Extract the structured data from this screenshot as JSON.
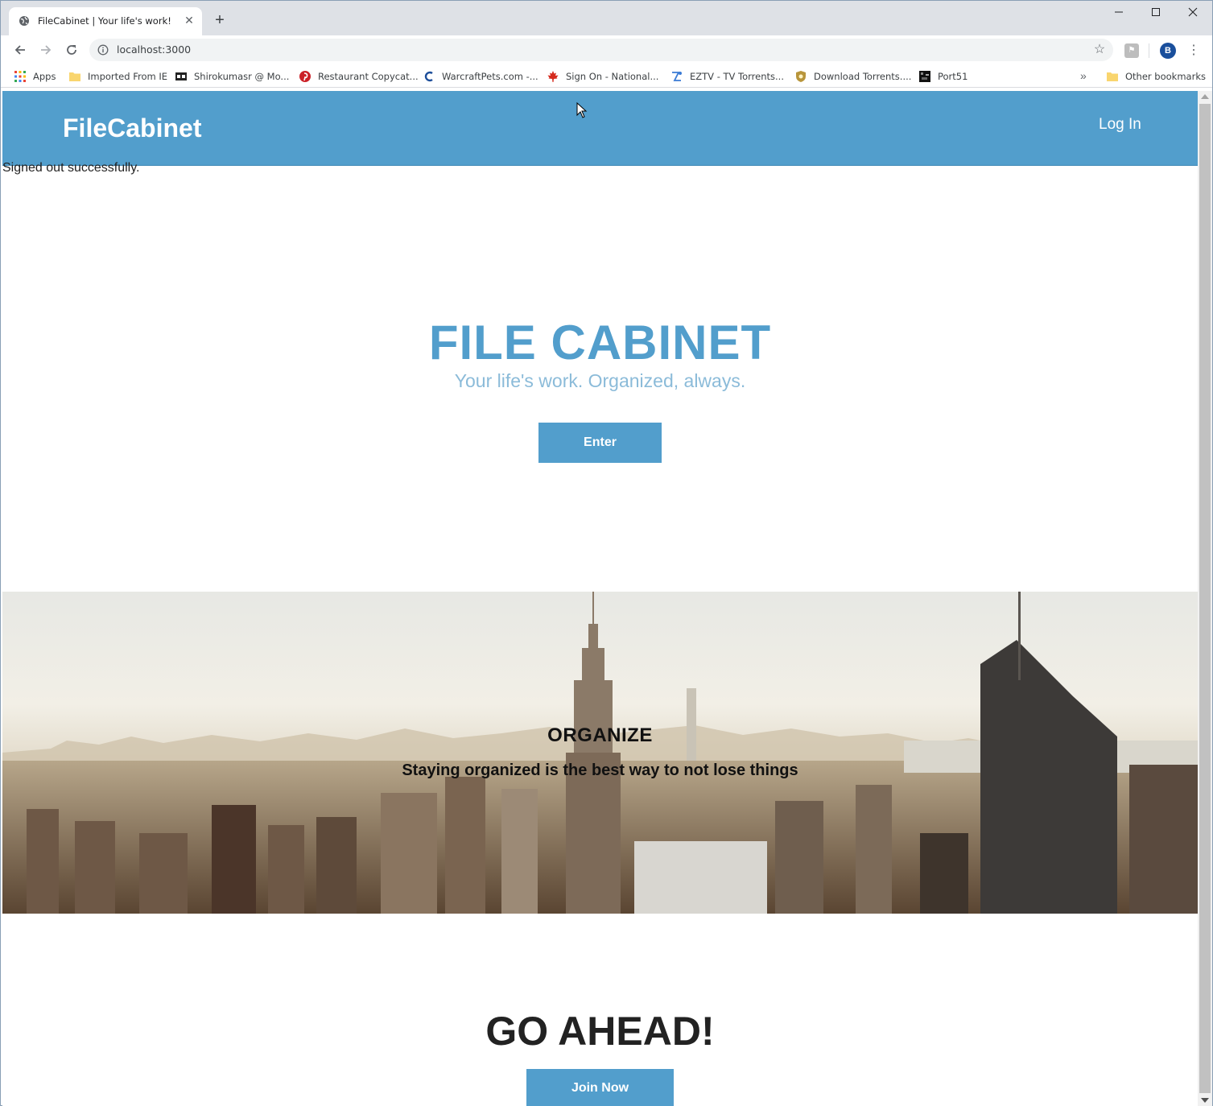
{
  "browser": {
    "tab_title": "FileCabinet | Your life's work!",
    "tab_close": "✕",
    "new_tab": "+",
    "url": "localhost:3000",
    "profile_initial": "B",
    "bookmarks": [
      {
        "label": "Apps",
        "icon": "apps-grid-icon"
      },
      {
        "label": "Imported From IE",
        "icon": "folder-icon"
      },
      {
        "label": "Shirokumasr @ Mo...",
        "icon": "film-icon"
      },
      {
        "label": "Restaurant Copycat...",
        "icon": "pinterest-icon"
      },
      {
        "label": "WarcraftPets.com -...",
        "icon": "warcraftpets-icon"
      },
      {
        "label": "Sign On - National...",
        "icon": "maple-leaf-icon"
      },
      {
        "label": "EZTV - TV Torrents...",
        "icon": "eztv-icon"
      },
      {
        "label": "Download Torrents....",
        "icon": "shield-icon"
      },
      {
        "label": "Port51",
        "icon": "port51-icon"
      }
    ],
    "bookmarks_more": "»",
    "other_bookmarks": "Other bookmarks"
  },
  "site": {
    "brand": "FileCabinet",
    "login": "Log In",
    "flash": "Signed out successfully.",
    "hero_title": "FILE CABINET",
    "hero_subtitle": "Your life's work. Organized, always.",
    "enter_button": "Enter",
    "organize_title": "ORGANIZE",
    "organize_subtitle": "Staying organized is the best way to not lose things",
    "go_title": "GO AHEAD!",
    "join_button": "Join Now"
  },
  "colors": {
    "brand_blue": "#529ecc",
    "subtitle_blue": "#8bbbd9"
  }
}
